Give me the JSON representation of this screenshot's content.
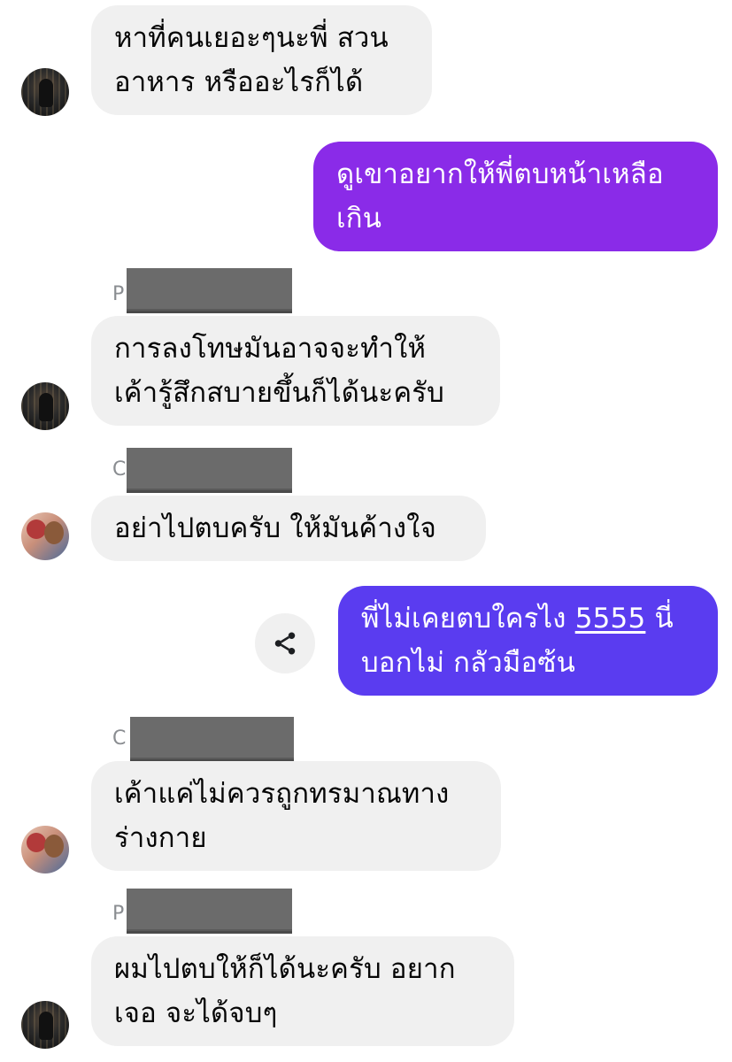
{
  "messages": [
    {
      "direction": "in",
      "lines": [
        "หาที่คนเยอะๆนะพี่ สวน",
        "อาหาร หรืออะไรก็ได้"
      ]
    },
    {
      "direction": "out",
      "lines": [
        "ดูเขาอยากให้พี่ตบหน้าเหลือ",
        "เกิน"
      ]
    },
    {
      "direction": "in",
      "sender_initial": "P",
      "lines": [
        "การลงโทษมันอาจจะทำให้",
        "เค้ารู้สึกสบายขึ้นก็ได้นะครับ"
      ]
    },
    {
      "direction": "in",
      "sender_initial": "C",
      "lines": [
        "อย่าไปตบครับ ให้มันค้างใจ"
      ]
    },
    {
      "direction": "out",
      "line1_prefix": "พี่ไม่เคยตบใครไง ",
      "line1_link": "5555",
      "line1_suffix": " นี่",
      "line2": "บอกไม่ กลัวมือซ้น"
    },
    {
      "direction": "in",
      "sender_initial": "C",
      "lines": [
        "เค้าแค่ไม่ควรถูกทรมาณทาง",
        "ร่างกาย"
      ]
    },
    {
      "direction": "in",
      "sender_initial": "P",
      "lines": [
        "ผมไปตบให้ก็ได้นะครับ อยาก",
        "เจอ จะได้จบๆ"
      ]
    }
  ],
  "icons": {
    "share": "share-icon",
    "avatar_1": "avatar",
    "avatar_2": "avatar"
  },
  "colors": {
    "incoming_bubble": "#f0f0f0",
    "outgoing_bubble_1": "#8a2be8",
    "outgoing_bubble_2": "#5a3cf0",
    "link_text": "#ffffff",
    "sender_text": "#8a8d91"
  }
}
